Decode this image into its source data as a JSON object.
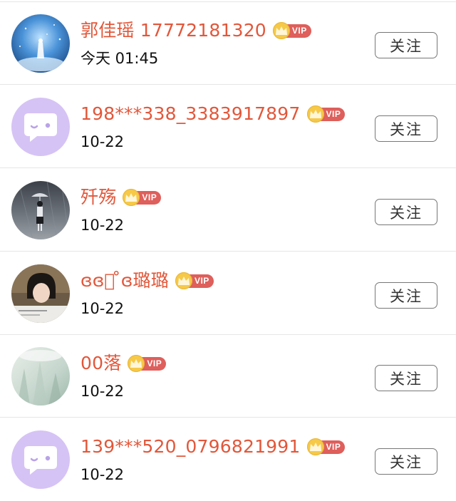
{
  "follow_list": [
    {
      "name": "郭佳瑶 17772181320",
      "vip_label": "VIP",
      "time": "今天 01:45",
      "follow_label": "关注",
      "avatar": "blue-night-sky-figure"
    },
    {
      "name": "198***338_3383917897",
      "vip_label": "VIP",
      "time": "10-22",
      "follow_label": "关注",
      "avatar": "default-chat-bubble"
    },
    {
      "name": "歼殇",
      "vip_label": "VIP",
      "time": "10-22",
      "follow_label": "关注",
      "avatar": "girl-with-umbrella"
    },
    {
      "name": "ɞɞ⃞ ̊ɞ璐璐",
      "vip_label": "VIP",
      "time": "10-22",
      "follow_label": "关注",
      "avatar": "short-hair-portrait"
    },
    {
      "name": "00落",
      "vip_label": "VIP",
      "time": "10-22",
      "follow_label": "关注",
      "avatar": "misty-painting"
    },
    {
      "name": "139***520_0796821991",
      "vip_label": "VIP",
      "time": "10-22",
      "follow_label": "关注",
      "avatar": "default-chat-bubble"
    }
  ],
  "colors": {
    "name": "#e2573a",
    "vip_tag": "#de5f5b",
    "crown": "#f6c948",
    "default_avatar": "#d6c3f5"
  }
}
